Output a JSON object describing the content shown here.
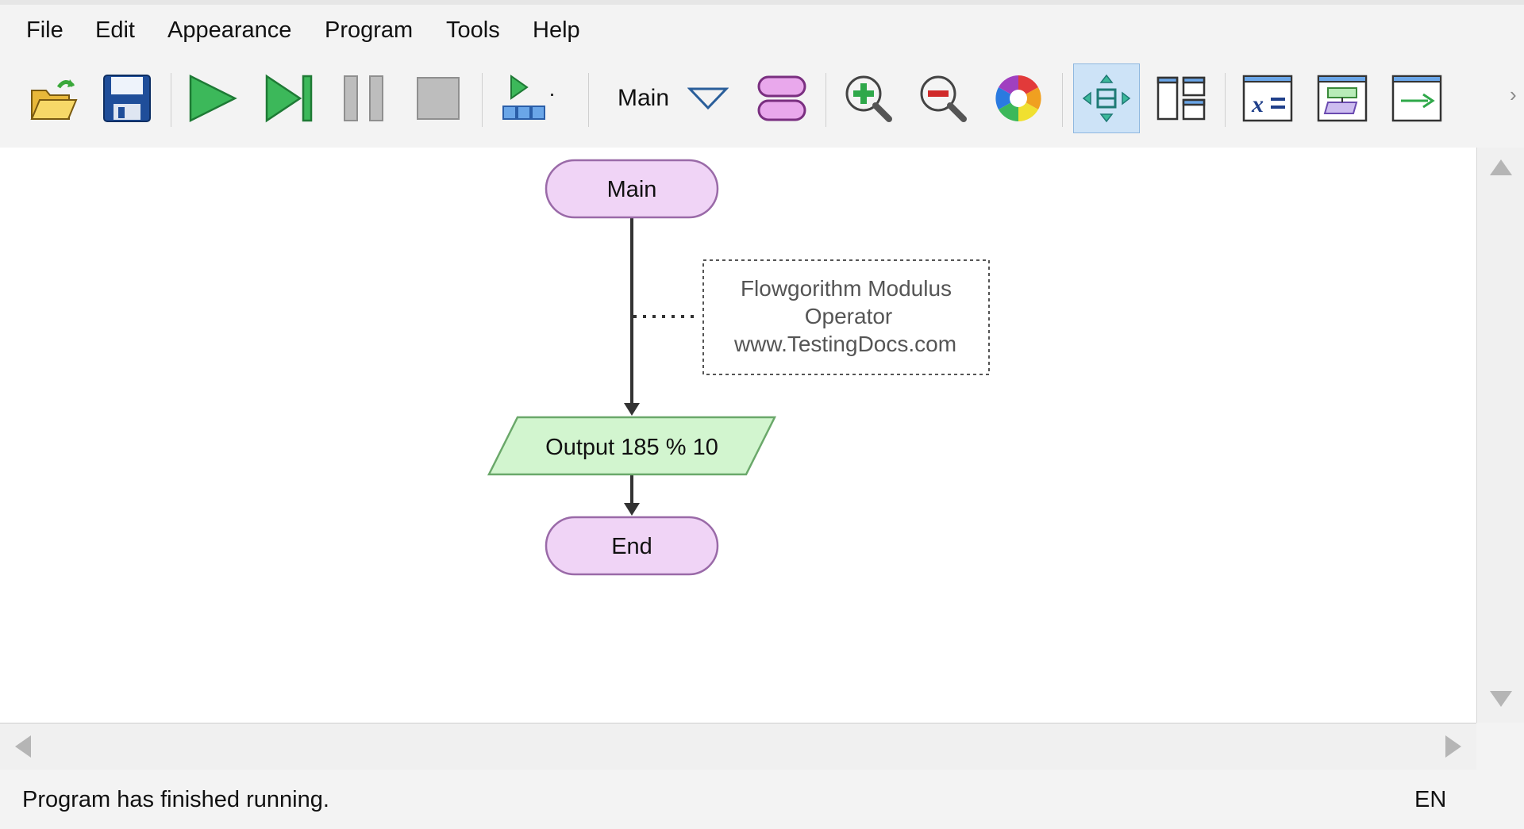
{
  "menu": {
    "file": "File",
    "edit": "Edit",
    "appearance": "Appearance",
    "program": "Program",
    "tools": "Tools",
    "help": "Help"
  },
  "toolbar": {
    "function_name": "Main",
    "icons": [
      "open-folder-icon",
      "save-icon",
      "run-icon",
      "step-icon",
      "pause-icon",
      "stop-icon",
      "run-speed-icon",
      "function-dropdown-icon",
      "function-manager-icon",
      "zoom-in-icon",
      "zoom-out-icon",
      "color-scheme-icon",
      "move-layout-icon",
      "layout-windows-icon",
      "variable-watch-icon",
      "source-code-icon",
      "console-icon",
      "toolbar-overflow-icon"
    ]
  },
  "flowchart": {
    "start_label": "Main",
    "output_label": "Output 185 % 10",
    "end_label": "End",
    "comment_lines": [
      "Flowgorithm Modulus",
      "Operator",
      "www.TestingDocs.com"
    ]
  },
  "status": {
    "message": "Program has finished running.",
    "language": "EN"
  },
  "colors": {
    "terminal_fill": "#f0d4f6",
    "terminal_stroke": "#9a6aa8",
    "output_fill": "#d2f5cf",
    "output_stroke": "#6aa86a",
    "selected_tool": "#cde3f7"
  }
}
